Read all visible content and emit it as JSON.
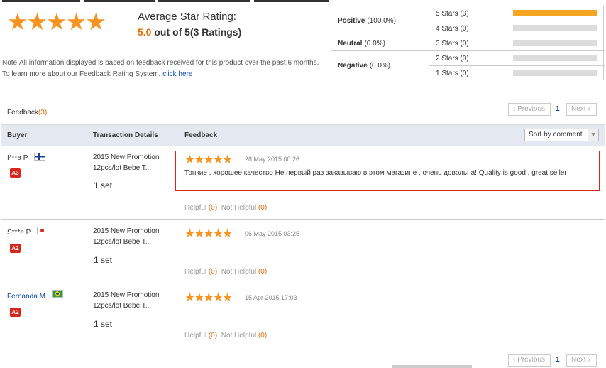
{
  "summary": {
    "stars": "★★★★★",
    "title": "Average Star Rating:",
    "score": "5.0",
    "score_suffix": " out of 5(3 Ratings)",
    "note_line1": "Note:All information displayed is based on feedback received for this product over the past 6 months.",
    "note_line2": "To learn more about our Feedback Rating System, ",
    "note_link": "click here"
  },
  "rating_table": {
    "positive_label": "Positive",
    "positive_value": "(100.0%)",
    "neutral_label": "Neutral",
    "neutral_value": "(0.0%)",
    "negative_label": "Negative",
    "negative_value": "(0.0%)",
    "rows": [
      {
        "label": "5 Stars (3)",
        "fraction": 1.0
      },
      {
        "label": "4 Stars (0)",
        "fraction": 0
      },
      {
        "label": "3 Stars (0)",
        "fraction": 0
      },
      {
        "label": "2 Stars (0)",
        "fraction": 0
      },
      {
        "label": "1 Stars (0)",
        "fraction": 0
      }
    ],
    "bar_fill_color": "#f5a623"
  },
  "feedback_header": {
    "label": "Feedback",
    "count": "(3)"
  },
  "pagination": {
    "previous": "Previous",
    "page": "1",
    "next": "Next"
  },
  "columns": {
    "buyer": "Buyer",
    "transaction": "Transaction Details",
    "feedback": "Feedback"
  },
  "sort": {
    "selected": "Sort by comment"
  },
  "feedback": [
    {
      "buyer": "I***a P.",
      "flag": "finland-flag",
      "badge": "A3",
      "product_line1": "2015 New Promotion",
      "product_line2": "12pcs/lot Bebe T...",
      "quantity": "1 set",
      "stars": "★★★★★",
      "date": "28 May 2015 00:26",
      "comment": "Тонкие , хорошее качество Не первый раз заказываю в этом магазине , очень довольна! Quality is good , great seller",
      "helpful": "Helpful",
      "helpful_count": "(0)",
      "not_helpful": "Not Helpful",
      "not_helpful_count": "(0)"
    },
    {
      "buyer": "S***e P.",
      "flag": "japan-flag",
      "badge": "A2",
      "product_line1": "2015 New Promotion",
      "product_line2": "12pcs/lot Bebe T...",
      "quantity": "1 set",
      "stars": "★★★★★",
      "date": "06 May 2015 03:25",
      "helpful": "Helpful",
      "helpful_count": "(0)",
      "not_helpful": "Not Helpful",
      "not_helpful_count": "(0)"
    },
    {
      "buyer": "Fernanda M.",
      "flag": "brazil-flag",
      "badge": "A2",
      "product_line1": "2015 New Promotion",
      "product_line2": "12pcs/lot Bebe T...",
      "quantity": "1 set",
      "stars": "★★★★★",
      "date": "15 Apr 2015 17:03",
      "helpful": "Helpful",
      "helpful_count": "(0)",
      "not_helpful": "Not Helpful",
      "not_helpful_count": "(0)"
    }
  ],
  "colors": {
    "accent_orange": "#e46c0a",
    "star": "#f7931e",
    "badge_red": "#d9261c",
    "link_blue": "#0645ad"
  }
}
